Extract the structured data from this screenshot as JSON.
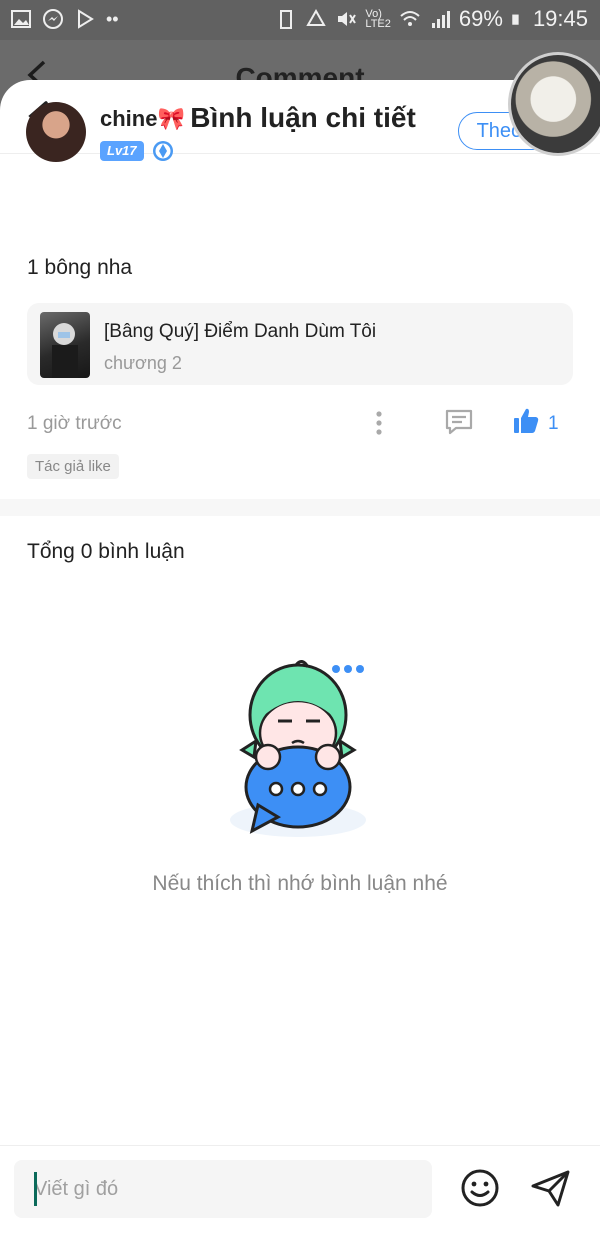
{
  "status_bar": {
    "battery": "69%",
    "time": "19:45"
  },
  "background_screen": {
    "title": "Comment"
  },
  "sheet": {
    "title": "Bình luận chi tiết"
  },
  "comment": {
    "username": "chine🎀",
    "level": "Lv17",
    "follow_label": "Theo dõi",
    "text": "1 bông nha",
    "story_title": "[Bâng Quý] Điểm Danh Dùm Tôi",
    "story_chapter": "chương 2",
    "time": "1 giờ trước",
    "like_count": "1",
    "author_like_tag": "Tác giả like"
  },
  "replies": {
    "total_label": "Tổng 0 bình luận",
    "empty_message": "Nếu thích thì nhớ bình luận nhé"
  },
  "composer": {
    "placeholder": "Viết gì đó"
  },
  "colors": {
    "accent_blue": "#3d8ff5",
    "level_badge": "#5aa3ff",
    "mascot_hair": "#6ee4b0",
    "mascot_bubble": "#3d8ff5"
  }
}
